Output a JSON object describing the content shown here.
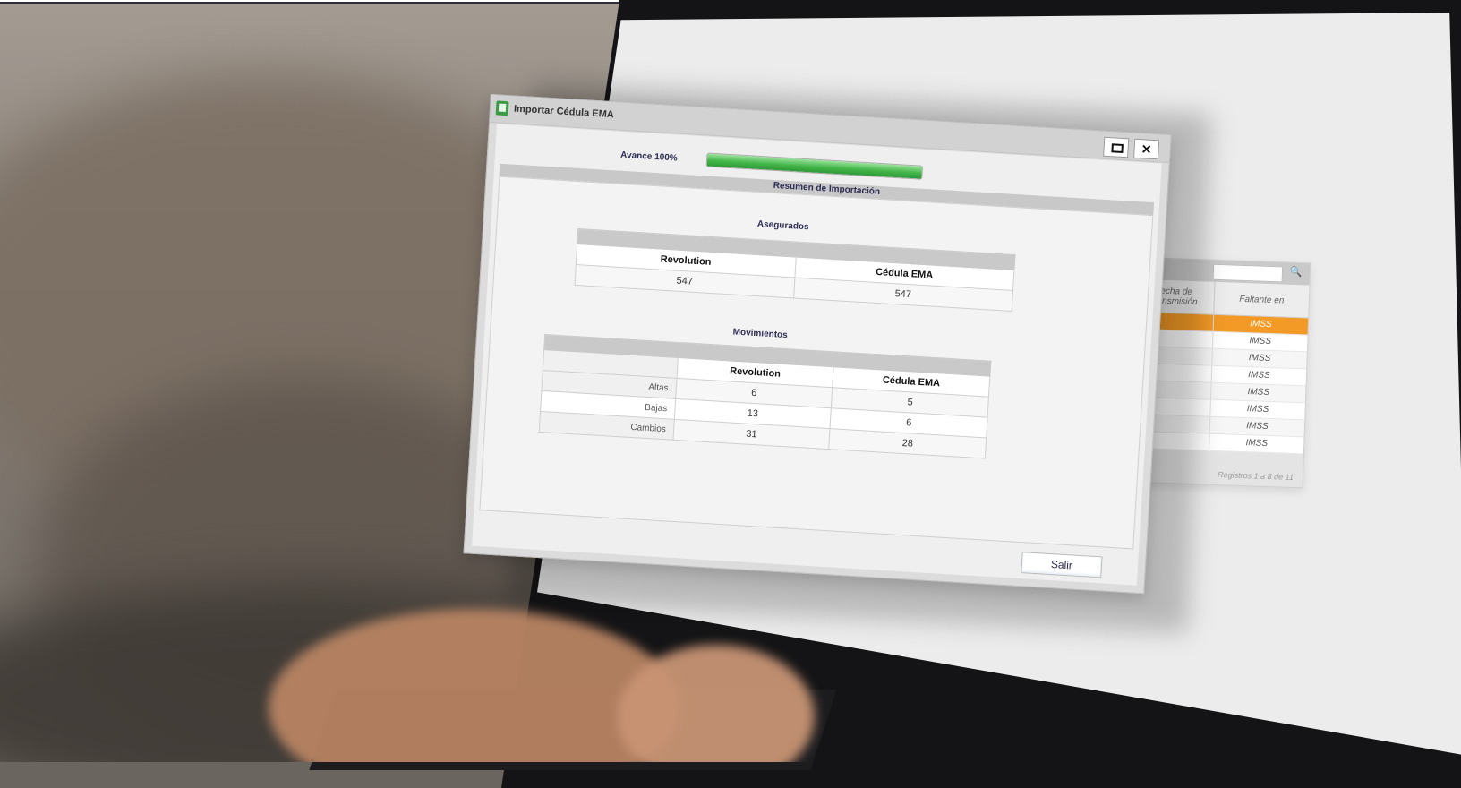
{
  "dialog": {
    "title": "Importar Cédula EMA",
    "progress_label": "Avance 100%",
    "progress_fraction": 1.0,
    "summary_header": "Resumen de Importación",
    "exit_label": "Salir"
  },
  "asegurados": {
    "title": "Asegurados",
    "headers": [
      "Revolution",
      "Cédula EMA"
    ],
    "values": [
      "547",
      "547"
    ]
  },
  "movimientos": {
    "title": "Movimientos",
    "headers": [
      "Revolution",
      "Cédula EMA"
    ],
    "rows": [
      {
        "label": "Altas",
        "revolution": "6",
        "cedula": "5"
      },
      {
        "label": "Bajas",
        "revolution": "13",
        "cedula": "6"
      },
      {
        "label": "Cambios",
        "revolution": "31",
        "cedula": "28"
      }
    ]
  },
  "back_grid": {
    "col1_header": "Fecha de Transmisión",
    "col2_header": "Faltante en",
    "rows": [
      "IMSS",
      "IMSS",
      "IMSS",
      "IMSS",
      "IMSS",
      "IMSS",
      "IMSS",
      "IMSS"
    ],
    "footer": "Registros 1 a 8 de 11"
  },
  "colors": {
    "accent_orange": "#f39a26",
    "progress_green": "#43b64a",
    "title_navy": "#2d2d55"
  }
}
